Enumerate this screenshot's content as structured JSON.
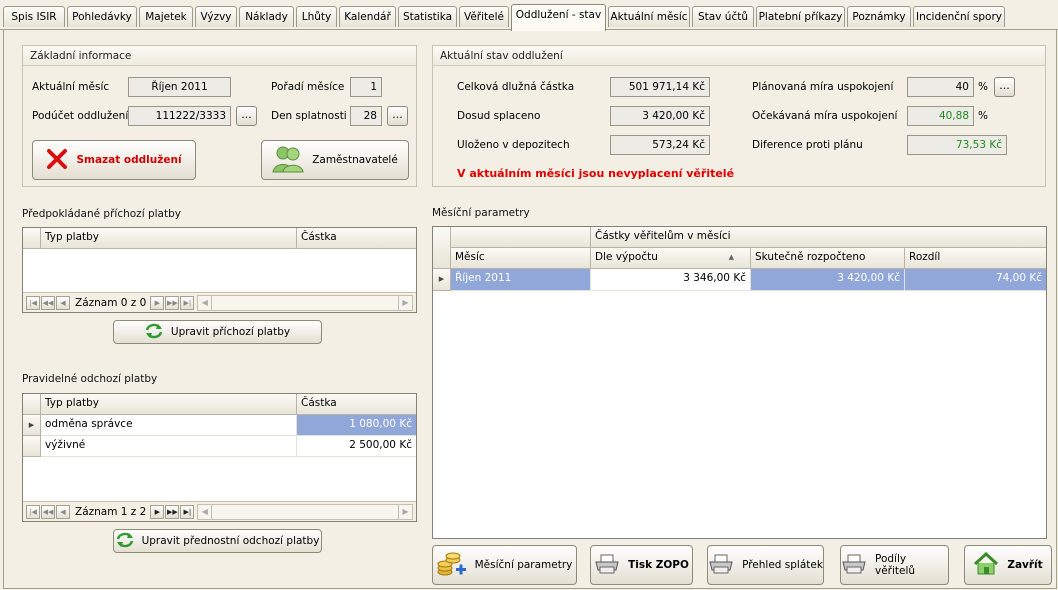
{
  "tabs": [
    "Spis ISIR",
    "Pohledávky",
    "Majetek",
    "Výzvy",
    "Náklady",
    "Lhůty",
    "Kalendář",
    "Statistika",
    "Věřitelé",
    "Oddlužení - stav",
    "Aktuální měsíc",
    "Stav účtů",
    "Platební příkazy",
    "Poznámky",
    "Incidenční spory"
  ],
  "active_tab": "Oddlužení - stav",
  "basic": {
    "title": "Základní informace",
    "month_label": "Aktuální měsíc",
    "month_value": "Říjen 2011",
    "order_label": "Pořadí měsíce",
    "order_value": "1",
    "subaccount_label": "Podúčet oddlužení",
    "subaccount_value": "111222/3333",
    "due_label": "Den splatnosti",
    "due_value": "28",
    "dots": "...",
    "delete_button": "Smazat oddlužení",
    "employers_button": "Zaměstnavatelé"
  },
  "status": {
    "title": "Aktuální stav oddlužení",
    "total_label": "Celková dlužná částka",
    "total_value": "501 971,14 Kč",
    "paid_label": "Dosud splaceno",
    "paid_value": "3 420,00 Kč",
    "deposit_label": "Uloženo v depozitech",
    "deposit_value": "573,24 Kč",
    "planned_label": "Plánovaná míra uspokojení",
    "planned_value": "40",
    "expected_label": "Očekávaná míra uspokojení",
    "expected_value": "40,88",
    "diff_label": "Diference proti plánu",
    "diff_value": "73,53 Kč",
    "pct": "%",
    "warning": "V aktuálním měsíci jsou nevyplacení věřitelé"
  },
  "incoming": {
    "title": "Předpokládané příchozí platby",
    "col_type": "Typ platby",
    "col_amount": "Částka",
    "nav_text": "Záznam 0 z 0",
    "button": "Upravit příchozí platby"
  },
  "outgoing": {
    "title": "Pravidelné odchozí platby",
    "col_type": "Typ platby",
    "col_amount": "Částka",
    "rows": [
      {
        "type": "odměna správce",
        "amount": "1 080,00 Kč"
      },
      {
        "type": "výživné",
        "amount": "2 500,00 Kč"
      }
    ],
    "nav_text": "Záznam 1 z 2",
    "button": "Upravit přednostní odchozí platby"
  },
  "monthly": {
    "title": "Měsíční parametry",
    "group_header": "Částky věřitelům v měsíci",
    "col_month": "Měsíc",
    "col_calc": "Dle výpočtu",
    "col_budget": "Skutečně rozpočteno",
    "col_diff": "Rozdíl",
    "rows": [
      {
        "month": "Říjen 2011",
        "calc": "3 346,00 Kč",
        "budget": "3 420,00 Kč",
        "diff": "74,00 Kč"
      }
    ]
  },
  "bottom_buttons": {
    "params": "Měsíční parametry",
    "print": "Tisk ZOPO",
    "overview": "Přehled splátek",
    "shares": "Podíly věřitelů",
    "close": "Zavřít"
  },
  "colors": {
    "selection": "#92a7d9",
    "warning": "#e00000",
    "green_value": "#1f8a1f"
  }
}
